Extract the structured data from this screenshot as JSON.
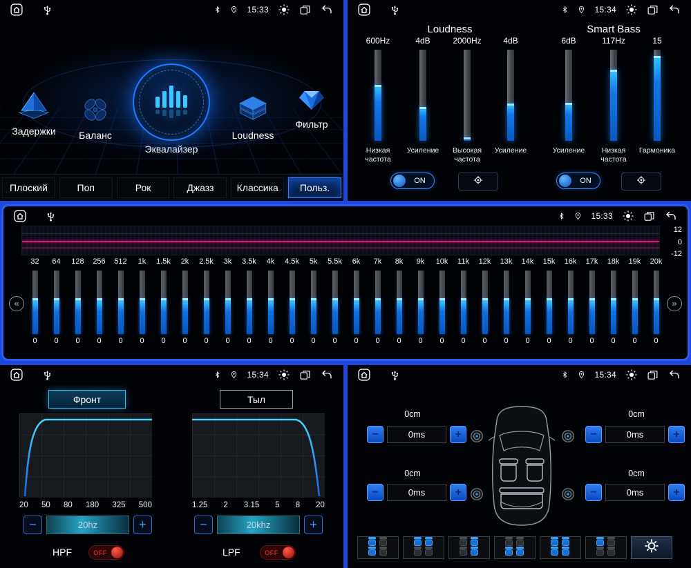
{
  "controls": {
    "minus": "−",
    "plus": "+"
  },
  "menu": {
    "time": "15:33",
    "items": [
      {
        "label": "Задержки",
        "icon": "delays-icon"
      },
      {
        "label": "Баланс",
        "icon": "balance-icon"
      },
      {
        "label": "Эквалайзер",
        "icon": "equalizer-icon",
        "active": true
      },
      {
        "label": "Loudness",
        "icon": "loudness-icon"
      },
      {
        "label": "Фильтр",
        "icon": "filter-icon"
      }
    ],
    "presets": [
      {
        "label": "Плоский",
        "active": false
      },
      {
        "label": "Поп",
        "active": false
      },
      {
        "label": "Рок",
        "active": false
      },
      {
        "label": "Джазз",
        "active": false
      },
      {
        "label": "Классика",
        "active": false
      },
      {
        "label": "Польз.",
        "active": true
      }
    ]
  },
  "loudness": {
    "time": "15:34",
    "sections": [
      {
        "title": "Loudness"
      },
      {
        "title": "Smart Bass"
      }
    ],
    "sliders": [
      {
        "value": "600Hz",
        "label": "Низкая частота",
        "fill": 0.61
      },
      {
        "value": "4dB",
        "label": "Усиление",
        "fill": 0.37
      },
      {
        "value": "2000Hz",
        "label": "Высокая частота",
        "fill": 0.04
      },
      {
        "value": "4dB",
        "label": "Усиление",
        "fill": 0.41
      },
      {
        "value": "6dB",
        "label": "Усиление",
        "fill": 0.42
      },
      {
        "value": "117Hz",
        "label": "Низкая частота",
        "fill": 0.78
      },
      {
        "value": "15",
        "label": "Гармоника",
        "fill": 0.93
      }
    ],
    "toggles": [
      {
        "label": "ON",
        "state": true
      },
      {
        "label": "ON",
        "state": true
      }
    ]
  },
  "equalizer": {
    "time": "15:33",
    "scale": [
      "12",
      "0",
      "-12"
    ],
    "band_fill": 0.57,
    "bands": [
      {
        "freq": "32",
        "value": "0"
      },
      {
        "freq": "64",
        "value": "0"
      },
      {
        "freq": "128",
        "value": "0"
      },
      {
        "freq": "256",
        "value": "0"
      },
      {
        "freq": "512",
        "value": "0"
      },
      {
        "freq": "1k",
        "value": "0"
      },
      {
        "freq": "1.5k",
        "value": "0"
      },
      {
        "freq": "2k",
        "value": "0"
      },
      {
        "freq": "2.5k",
        "value": "0"
      },
      {
        "freq": "3k",
        "value": "0"
      },
      {
        "freq": "3.5k",
        "value": "0"
      },
      {
        "freq": "4k",
        "value": "0"
      },
      {
        "freq": "4.5k",
        "value": "0"
      },
      {
        "freq": "5k",
        "value": "0"
      },
      {
        "freq": "5.5k",
        "value": "0"
      },
      {
        "freq": "6k",
        "value": "0"
      },
      {
        "freq": "7k",
        "value": "0"
      },
      {
        "freq": "8k",
        "value": "0"
      },
      {
        "freq": "9k",
        "value": "0"
      },
      {
        "freq": "10k",
        "value": "0"
      },
      {
        "freq": "11k",
        "value": "0"
      },
      {
        "freq": "12k",
        "value": "0"
      },
      {
        "freq": "13k",
        "value": "0"
      },
      {
        "freq": "14k",
        "value": "0"
      },
      {
        "freq": "15k",
        "value": "0"
      },
      {
        "freq": "16k",
        "value": "0"
      },
      {
        "freq": "17k",
        "value": "0"
      },
      {
        "freq": "18k",
        "value": "0"
      },
      {
        "freq": "19k",
        "value": "0"
      },
      {
        "freq": "20k",
        "value": "0"
      }
    ]
  },
  "filter": {
    "time": "15:34",
    "tabs": [
      {
        "label": "Фронт",
        "active": true
      },
      {
        "label": "Тыл",
        "active": false
      }
    ],
    "hpf": {
      "name": "HPF",
      "axis": [
        "20",
        "50",
        "80",
        "180",
        "325",
        "500"
      ],
      "value": "20hz",
      "state": "OFF"
    },
    "lpf": {
      "name": "LPF",
      "axis": [
        "1.25",
        "2",
        "3.15",
        "5",
        "8",
        "20"
      ],
      "value": "20khz",
      "state": "OFF"
    }
  },
  "delay": {
    "time": "15:34",
    "corners": [
      {
        "position": "front-left",
        "distance": "0cm",
        "delay": "0ms"
      },
      {
        "position": "front-right",
        "distance": "0cm",
        "delay": "0ms"
      },
      {
        "position": "rear-left",
        "distance": "0cm",
        "delay": "0ms"
      },
      {
        "position": "rear-right",
        "distance": "0cm",
        "delay": "0ms"
      }
    ],
    "seat_presets": [
      {
        "name": "left-seats",
        "highlights": [
          1,
          0,
          1,
          0
        ]
      },
      {
        "name": "front-seats",
        "highlights": [
          1,
          1,
          0,
          0
        ]
      },
      {
        "name": "right-seats",
        "highlights": [
          0,
          1,
          0,
          1
        ]
      },
      {
        "name": "rear-seats",
        "highlights": [
          0,
          0,
          1,
          1
        ]
      },
      {
        "name": "all-seats",
        "highlights": [
          1,
          1,
          1,
          1
        ]
      },
      {
        "name": "driver-seat",
        "highlights": [
          1,
          0,
          0,
          0
        ]
      }
    ]
  }
}
